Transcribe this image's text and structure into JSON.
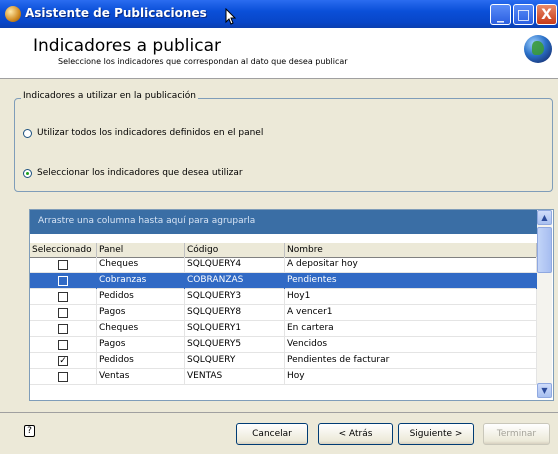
{
  "window": {
    "title": "Asistente de Publicaciones",
    "controls": {
      "minimize": "_",
      "maximize": "□",
      "close": "X"
    }
  },
  "header": {
    "title": "Indicadores a publicar",
    "subtitle": "Seleccione los indicadores que correspondan al dato que desea publicar"
  },
  "group": {
    "legend": "Indicadores a utilizar en la publicación",
    "options": [
      {
        "label": "Utilizar todos los indicadores definidos en el panel",
        "selected": false
      },
      {
        "label": "Seleccionar los indicadores que desea utilizar",
        "selected": true
      }
    ]
  },
  "grid": {
    "group_hint": "Arrastre una columna hasta aquí para agruparla",
    "columns": [
      "Seleccionado",
      "Panel",
      "Código",
      "Nombre"
    ],
    "rows": [
      {
        "checked": false,
        "panel": "Cheques",
        "codigo": "SQLQUERY4",
        "nombre": "A depositar hoy",
        "selected": false
      },
      {
        "checked": false,
        "panel": "Cobranzas",
        "codigo": "COBRANZAS",
        "nombre": "Pendientes",
        "selected": true
      },
      {
        "checked": false,
        "panel": "Pedidos",
        "codigo": "SQLQUERY3",
        "nombre": "Hoy1",
        "selected": false
      },
      {
        "checked": false,
        "panel": "Pagos",
        "codigo": "SQLQUERY8",
        "nombre": "A vencer1",
        "selected": false
      },
      {
        "checked": false,
        "panel": "Cheques",
        "codigo": "SQLQUERY1",
        "nombre": "En cartera",
        "selected": false
      },
      {
        "checked": false,
        "panel": "Pagos",
        "codigo": "SQLQUERY5",
        "nombre": "Vencidos",
        "selected": false
      },
      {
        "checked": true,
        "panel": "Pedidos",
        "codigo": "SQLQUERY",
        "nombre": "Pendientes de facturar",
        "selected": false
      },
      {
        "checked": false,
        "panel": "Ventas",
        "codigo": "VENTAS",
        "nombre": "Hoy",
        "selected": false
      }
    ],
    "check_mark": "✓"
  },
  "footer": {
    "help": "?",
    "buttons": {
      "cancel": "Cancelar",
      "back": "< Atrás",
      "next": "Siguiente >",
      "finish": "Terminar"
    }
  },
  "colors": {
    "title_bar": "#0a4fd8",
    "selection": "#316ac5",
    "group_header": "#3a6ea5"
  }
}
